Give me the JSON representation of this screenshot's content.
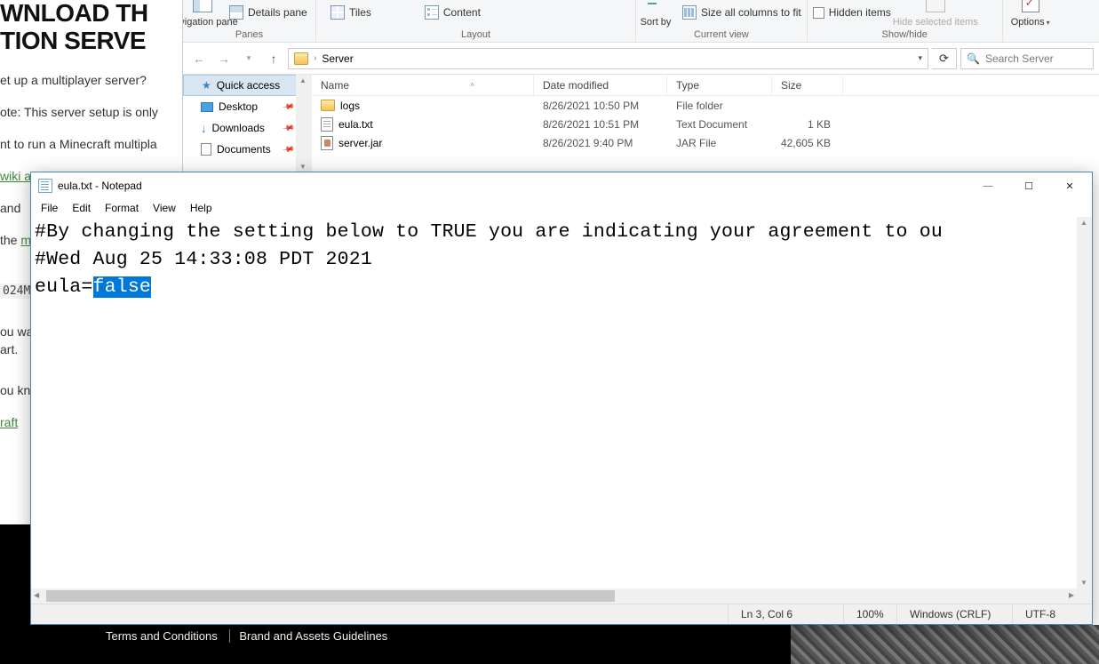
{
  "bg": {
    "h1a": "WNLOAD TH",
    "h1b": "TION SERVE",
    "p1": "et up a multiplayer server?",
    "p2": "ote: This server setup is only ",
    "p3": "nt to run a Minecraft multipla",
    "wiki": "wiki a",
    "p4": " and ",
    "p5": " the ",
    "mine": "mine",
    "mono": "024M",
    "p6": "ou wa",
    "p7": "art.",
    "p8": "ou kn",
    "raft": "raft ",
    "footer_tc": "Terms and Conditions",
    "footer_brand": "Brand and Assets Guidelines"
  },
  "explorer": {
    "ribbon": {
      "nav_pane": "Navigation pane",
      "details_pane": "Details pane",
      "panes": "Panes",
      "tiles": "Tiles",
      "content": "Content",
      "layout": "Layout",
      "sort_by": "Sort by",
      "size_cols": "Size all columns to fit",
      "current_view": "Current view",
      "hidden_items": "Hidden items",
      "hide_selected": "Hide selected items",
      "show_hide": "Show/hide",
      "options": "Options"
    },
    "address": {
      "crumb": "Server",
      "search_placeholder": "Search Server"
    },
    "nav": {
      "quick": "Quick access",
      "desktop": "Desktop",
      "downloads": "Downloads",
      "documents": "Documents"
    },
    "columns": {
      "name": "Name",
      "date": "Date modified",
      "type": "Type",
      "size": "Size"
    },
    "files": [
      {
        "name": "logs",
        "date": "8/26/2021 10:50 PM",
        "type": "File folder",
        "size": "",
        "icon": "folder"
      },
      {
        "name": "eula.txt",
        "date": "8/26/2021 10:51 PM",
        "type": "Text Document",
        "size": "1 KB",
        "icon": "txt"
      },
      {
        "name": "server.jar",
        "date": "8/26/2021 9:40 PM",
        "type": "JAR File",
        "size": "42,605 KB",
        "icon": "jar"
      }
    ]
  },
  "notepad": {
    "title": "eula.txt - Notepad",
    "menu": {
      "file": "File",
      "edit": "Edit",
      "format": "Format",
      "view": "View",
      "help": "Help"
    },
    "line1": "#By changing the setting below to TRUE you are indicating your agreement to ou",
    "line2": "#Wed Aug 25 14:33:08 PDT 2021",
    "line3_prefix": "eula=",
    "line3_selected": "false",
    "status": {
      "pos": "Ln 3, Col 6",
      "zoom": "100%",
      "eol": "Windows (CRLF)",
      "enc": "UTF-8"
    }
  }
}
